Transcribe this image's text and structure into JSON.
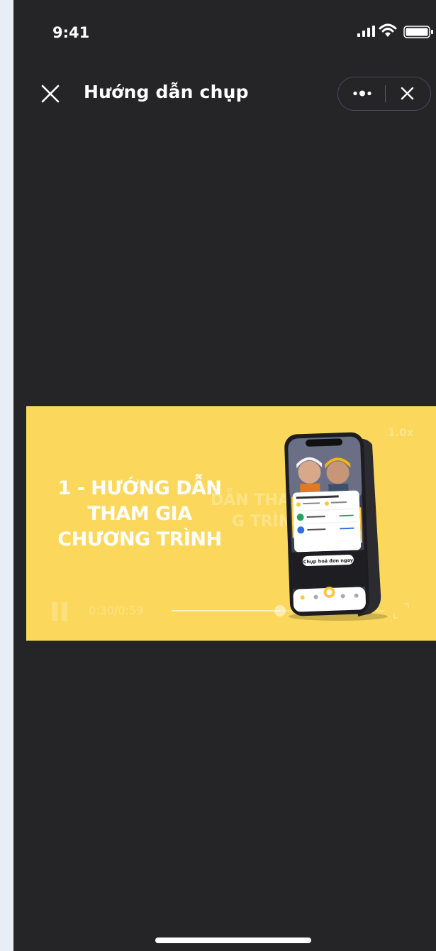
{
  "status": {
    "time": "9:41"
  },
  "nav": {
    "title": "Hướng dẫn chụp"
  },
  "video": {
    "title_lines": [
      "1 - HƯỚNG DẪN",
      "THAM GIA",
      "CHƯƠNG TRÌNH"
    ],
    "current_time": "0:30",
    "duration": "0:59",
    "progress": 0.51,
    "speed": "1.0x",
    "phone_screen": {
      "cta": "Chụp hoá đơn ngay"
    }
  },
  "colors": {
    "background": "#252528",
    "video_bg": "#fbd85c",
    "accent": "#ffc83a"
  }
}
